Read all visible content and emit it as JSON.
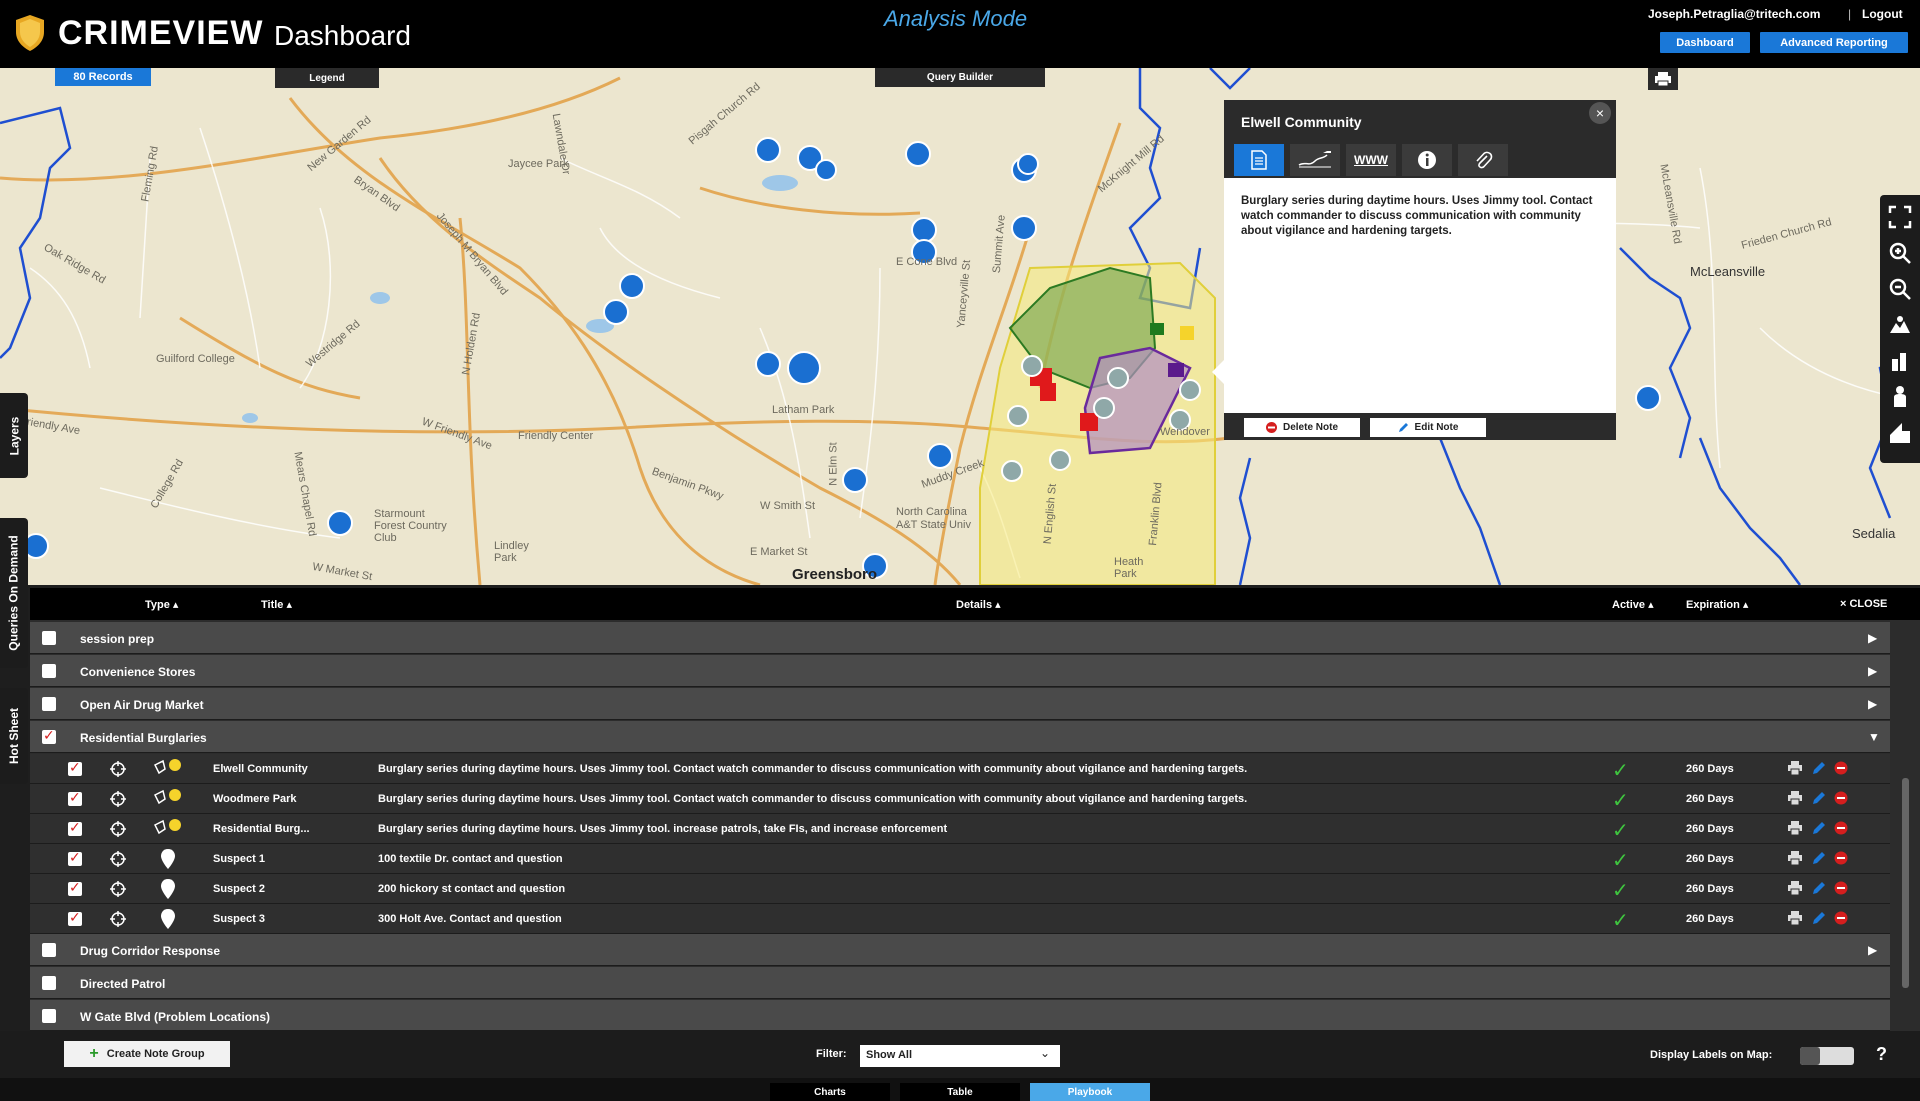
{
  "header": {
    "brand": "CRIMEVIEW",
    "brand_sub": "Dashboard",
    "mode": "Analysis Mode",
    "user": "Joseph.Petraglia@tritech.com",
    "separator": "|",
    "logout": "Logout",
    "dashboard_btn": "Dashboard",
    "advanced_btn": "Advanced Reporting"
  },
  "map": {
    "records": "80 Records",
    "legend": "Legend",
    "query_builder": "Query Builder",
    "labels": [
      "Bryan Blvd",
      "Fleming Rd",
      "New Garden Rd",
      "Lawndale Dr",
      "Jaycee Park",
      "Pisgah Church Rd",
      "Joseph M Bryan Blvd",
      "Oak Ridge Rd",
      "Westridge Rd",
      "Guilford College",
      "Friendly Ave",
      "N Holden Rd",
      "W Friendly Ave",
      "Friendly Center",
      "Latham Park",
      "College Rd",
      "Starmount Forest Country Club",
      "Lindley Park",
      "W Market St",
      "Benjamin Pkwy",
      "W Smith St",
      "N Elm St",
      "Yanceyville St",
      "E Cone Blvd",
      "Summit Ave",
      "McKnight Mill Rd",
      "E Market St",
      "North Carolina A&T State Univ",
      "Greensboro",
      "Heath Park",
      "Franklin Blvd",
      "Wendover",
      "McLeansville",
      "Frieden Church Rd",
      "McLeansville Rd",
      "Sedalia",
      "Muddy Creek",
      "N English St",
      "Mears Chapel Rd"
    ]
  },
  "left_tabs": [
    "Layers",
    "Queries On Demand",
    "Hot Sheet"
  ],
  "popup": {
    "title": "Elwell Community",
    "close": "×",
    "tabs": [
      "note-icon",
      "signature-icon",
      "www",
      "info-icon",
      "attachment-icon"
    ],
    "www_label": "WWW",
    "body": "Burglary series during daytime hours. Uses Jimmy tool. Contact watch commander to discuss communication with community about vigilance and hardening targets.",
    "delete_btn": "Delete Note",
    "edit_btn": "Edit Note"
  },
  "table": {
    "headers": {
      "type": "Type",
      "title": "Title",
      "details": "Details",
      "active": "Active",
      "expiration": "Expiration",
      "close": "CLOSE"
    },
    "groups": [
      {
        "title": "session prep",
        "checked": false,
        "expanded": false
      },
      {
        "title": "Convenience Stores",
        "checked": false,
        "expanded": false
      },
      {
        "title": "Open Air Drug Market",
        "checked": false,
        "expanded": false
      },
      {
        "title": "Residential Burglaries",
        "checked": true,
        "expanded": true
      },
      {
        "title": "Drug Corridor Response",
        "checked": false,
        "expanded": false
      },
      {
        "title": "Directed Patrol",
        "checked": false,
        "expanded": false
      },
      {
        "title": "W Gate Blvd (Problem Locations)",
        "checked": false,
        "expanded": false
      }
    ],
    "items": [
      {
        "type": "area-icon",
        "title": "Elwell Community",
        "details": "Burglary series during daytime hours. Uses Jimmy tool. Contact watch commander to discuss communication with community about vigilance and hardening targets.",
        "active": true,
        "expiration": "260 Days"
      },
      {
        "type": "area-icon",
        "title": "Woodmere Park",
        "details": "Burglary series during daytime hours. Uses Jimmy tool. Contact watch commander to discuss communication with community about vigilance and hardening targets.",
        "active": true,
        "expiration": "260 Days"
      },
      {
        "type": "area-icon",
        "title": "Residential Burg...",
        "details": "Burglary series during daytime hours. Uses Jimmy tool. increase patrols, take FIs, and increase enforcement",
        "active": true,
        "expiration": "260 Days"
      },
      {
        "type": "pin-icon",
        "title": "Suspect 1",
        "details": "100 textile Dr. contact and question",
        "active": true,
        "expiration": "260 Days"
      },
      {
        "type": "pin-icon",
        "title": "Suspect 2",
        "details": "200 hickory st contact and question",
        "active": true,
        "expiration": "260 Days"
      },
      {
        "type": "pin-icon",
        "title": "Suspect 3",
        "details": "300 Holt Ave. Contact and question",
        "active": true,
        "expiration": "260 Days"
      }
    ]
  },
  "footer": {
    "create_btn": "Create Note Group",
    "filter_label": "Filter:",
    "filter_value": "Show All",
    "display_labels": "Display Labels on Map:",
    "help": "?"
  },
  "bottom_tabs": [
    {
      "label": "Charts",
      "active": false
    },
    {
      "label": "Table",
      "active": false
    },
    {
      "label": "Playbook",
      "active": true
    }
  ],
  "colors": {
    "accent": "#1a78d8",
    "mode": "#4aa8e8",
    "active_check": "#3fc53f",
    "remove": "#d51e1e"
  }
}
